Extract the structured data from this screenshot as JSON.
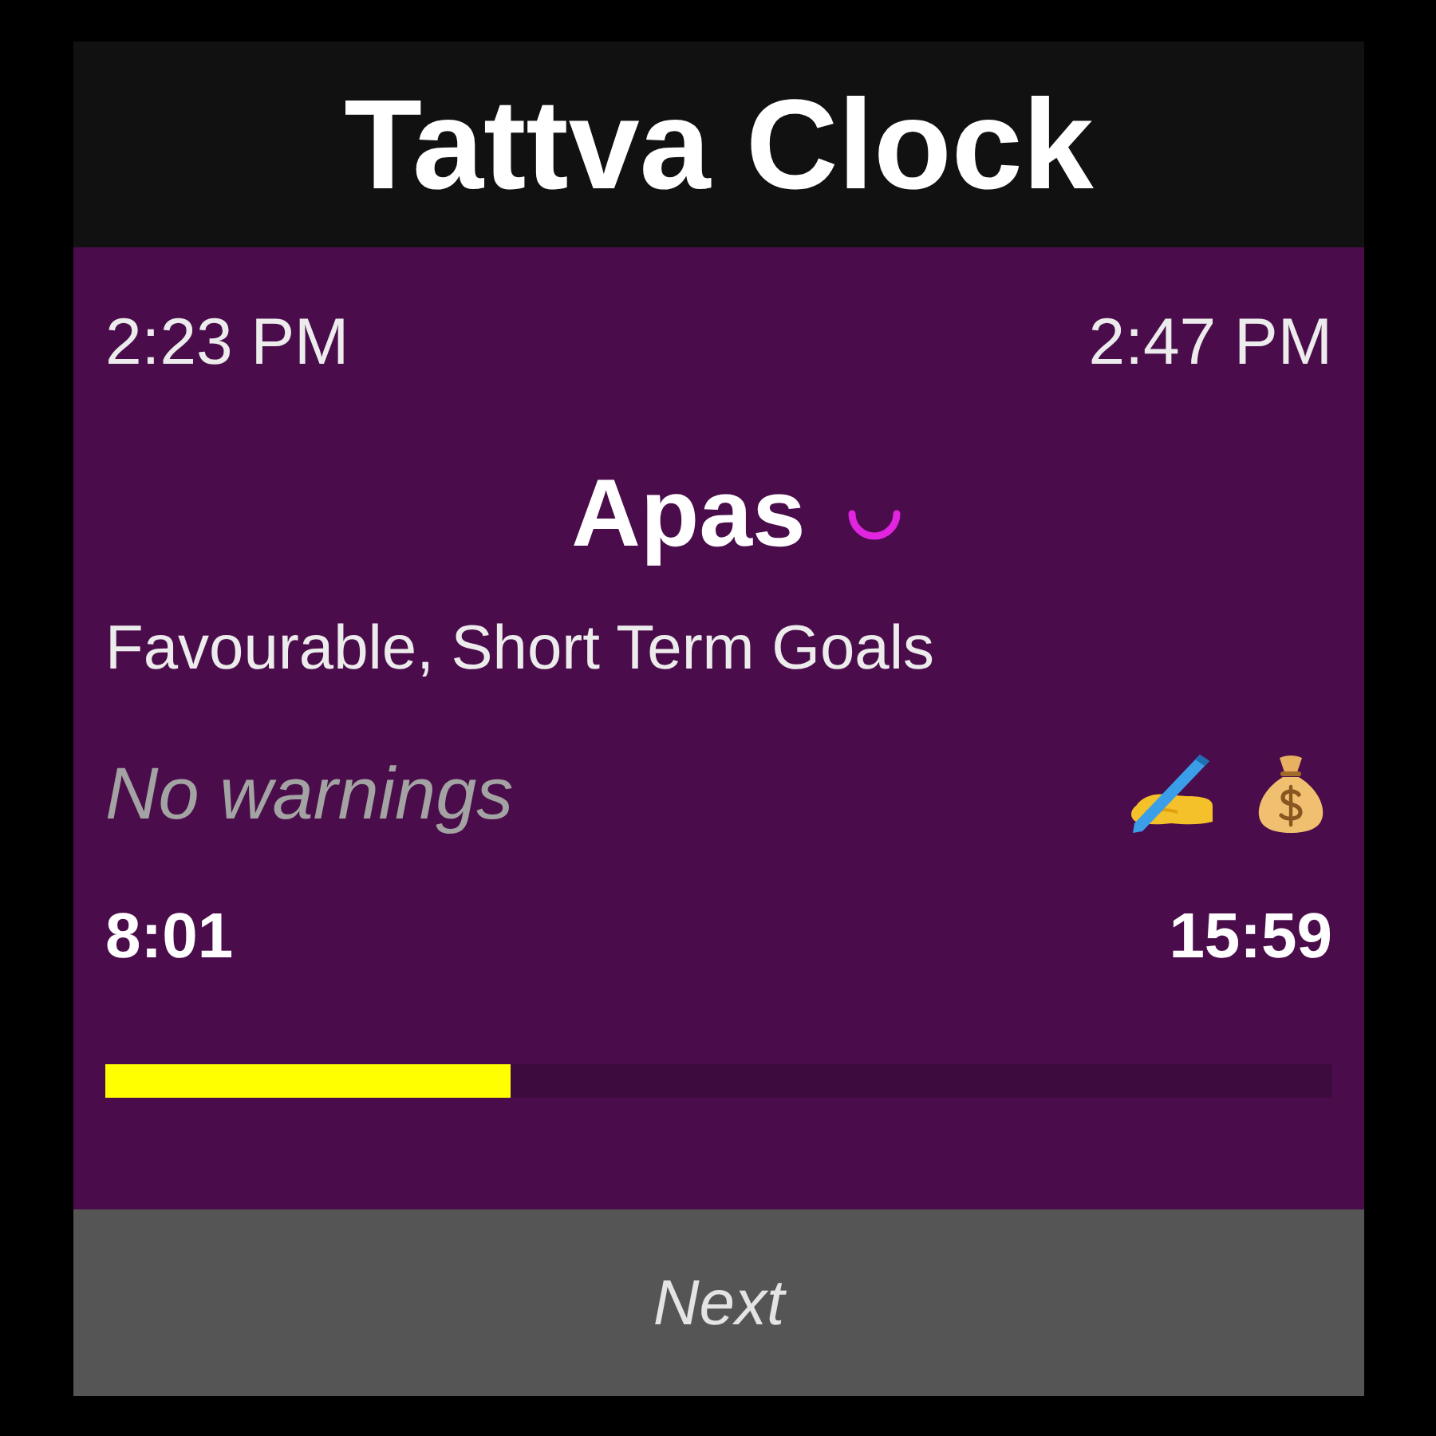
{
  "header": {
    "title": "Tattva Clock"
  },
  "period": {
    "start_time": "2:23 PM",
    "end_time": "2:47 PM"
  },
  "tattva": {
    "name": "Apas",
    "description": "Favourable, Short Term Goals",
    "warnings": "No warnings"
  },
  "timer": {
    "elapsed": "8:01",
    "remaining": "15:59",
    "level": 0.33
  },
  "footer": {
    "button": "Next"
  }
}
